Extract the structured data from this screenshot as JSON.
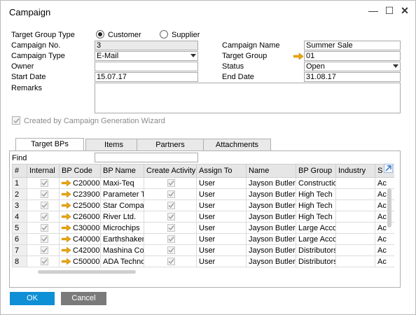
{
  "window": {
    "title": "Campaign"
  },
  "header": {
    "target_group_type_label": "Target Group Type",
    "radio_customer": "Customer",
    "radio_supplier": "Supplier",
    "campaign_no_label": "Campaign No.",
    "campaign_no_value": "3",
    "campaign_type_label": "Campaign Type",
    "campaign_type_value": "E-Mail",
    "owner_label": "Owner",
    "owner_value": "",
    "start_date_label": "Start Date",
    "start_date_value": "15.07.17",
    "remarks_label": "Remarks",
    "campaign_name_label": "Campaign Name",
    "campaign_name_value": "Summer Sale",
    "target_group_label": "Target Group",
    "target_group_value": "01",
    "status_label": "Status",
    "status_value": "Open",
    "end_date_label": "End Date",
    "end_date_value": "31.08.17",
    "wizard_label": "Created by Campaign Generation Wizard"
  },
  "tabs": [
    {
      "label": "Target BPs"
    },
    {
      "label": "Items"
    },
    {
      "label": "Partners"
    },
    {
      "label": "Attachments"
    }
  ],
  "find_label": "Find",
  "grid": {
    "columns": [
      "#",
      "Internal",
      "BP Code",
      "BP Name",
      "Create Activity",
      "Assign To",
      "Name",
      "BP Group",
      "Industry",
      "S"
    ],
    "rows": [
      {
        "num": "1",
        "code": "C20000",
        "name": "Maxi-Teq",
        "assign": "User",
        "person": "Jayson Butler",
        "group": "Construction",
        "industry": "",
        "s": "Ac"
      },
      {
        "num": "2",
        "code": "C23900",
        "name": "Parameter Te",
        "assign": "User",
        "person": "Jayson Butler",
        "group": "High Tech",
        "industry": "",
        "s": "Ac"
      },
      {
        "num": "3",
        "code": "C25000",
        "name": "Star Compan",
        "assign": "User",
        "person": "Jayson Butler",
        "group": "High Tech",
        "industry": "",
        "s": "Ac"
      },
      {
        "num": "4",
        "code": "C26000",
        "name": "River Ltd.",
        "assign": "User",
        "person": "Jayson Butler",
        "group": "High Tech",
        "industry": "",
        "s": "Ac"
      },
      {
        "num": "5",
        "code": "C30000",
        "name": "Microchips",
        "assign": "User",
        "person": "Jayson Butler",
        "group": "Large Accou",
        "industry": "",
        "s": "Ac"
      },
      {
        "num": "6",
        "code": "C40000",
        "name": "Earthshaker",
        "assign": "User",
        "person": "Jayson Butler",
        "group": "Large Accou",
        "industry": "",
        "s": "Ac"
      },
      {
        "num": "7",
        "code": "C42000",
        "name": "Mashina Corp",
        "assign": "User",
        "person": "Jayson Butler",
        "group": "Distributors",
        "industry": "",
        "s": "Ac"
      },
      {
        "num": "8",
        "code": "C50000",
        "name": "ADA Techno",
        "assign": "User",
        "person": "Jayson Butler",
        "group": "Distributors",
        "industry": "",
        "s": "Ac"
      }
    ]
  },
  "buttons": {
    "ok": "OK",
    "cancel": "Cancel"
  },
  "colors": {
    "ok_bg": "#0f8fd6",
    "cancel_bg": "#7a7a7a",
    "link_arrow": "#f0a800"
  }
}
